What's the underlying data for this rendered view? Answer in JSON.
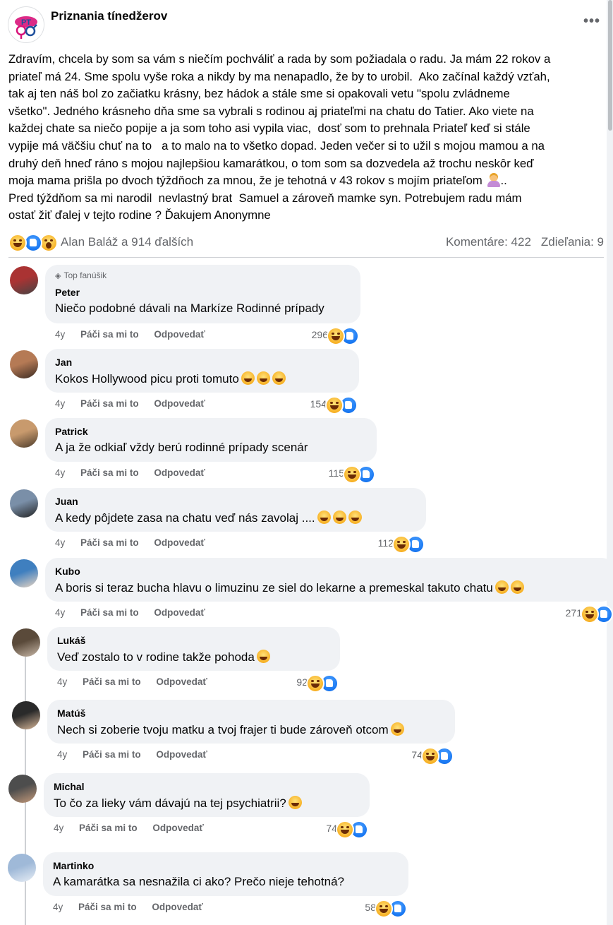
{
  "post": {
    "page_name": "Priznania tínedžerov",
    "more_label": "•••",
    "body": "Zdravím, chcela by som sa vám s niečím pochváliť a rada by som požiadala o radu. Ja mám 22 rokov a\npriateľ má 24. Sme spolu vyše roka a nikdy by ma nenapadlo, že by to urobil.  Ako začínal každý vzťah,\ntak aj ten náš bol zo začiatku krásny, bez hádok a stále sme si opakovali vetu \"spolu zvládneme\nvšetko\". Jedného krásneho dňa sme sa vybrali s rodinou aj priateľmi na chatu do Tatier. Ako viete na\nkaždej chate sa niečo popije a ja som toho asi vypila viac,  dosť som to prehnala Priateľ keď si stále\nvypije má väčšiu chuť na to   a to malo na to všetko dopad. Jeden večer si to užil s mojou mamou a na\ndruhý deň hneď ráno s mojou najlepšiou kamarátkou, o tom som sa dozvedela až trochu neskôr keď\nmoja mama prišla po dvoch týždňoch za mnou, že je tehotná v 43 rokov s mojím priateľom",
    "body_tail": "..\nPred týždňom sa mi narodil  nevlastný brat  Samuel a zároveň mamke syn. Potrebujem radu mám\nostať žiť ďalej v tejto rodine ? Ďakujem Anonymne",
    "reactions_text": "Alan Baláž a 914 ďalších",
    "comments_label": "Komentáre: 422",
    "shares_label": "Zdieľania: 9"
  },
  "comments": [
    {
      "badge": "Top fanúšik",
      "author": "Peter",
      "text": "Niečo podobné dávali na Markíze Rodinné prípady",
      "emoji": "",
      "age": "4y",
      "like": "Páči sa mi to",
      "reply": "Odpovedať",
      "count": "296"
    },
    {
      "badge": "",
      "author": "Jan",
      "text": "Kokos Hollywood picu proti tomuto",
      "emoji": "😂😂😂",
      "age": "4y",
      "like": "Páči sa mi to",
      "reply": "Odpovedať",
      "count": "154"
    },
    {
      "badge": "",
      "author": "Patrick",
      "text": "A ja že odkiaľ vždy berú rodinné prípady scenár",
      "emoji": "",
      "age": "4y",
      "like": "Páči sa mi to",
      "reply": "Odpovedať",
      "count": "115"
    },
    {
      "badge": "",
      "author": "Juan",
      "text": "A kedy pôjdete zasa na chatu veď nás zavolaj ....",
      "emoji": "🤣🤣🤣",
      "age": "4y",
      "like": "Páči sa mi to",
      "reply": "Odpovedať",
      "count": "112"
    },
    {
      "badge": "",
      "author": "Kubo",
      "text": "A boris si teraz bucha hlavu o limuzinu ze siel do lekarne a premeskal takuto chatu",
      "emoji": "😁😁",
      "age": "4y",
      "like": "Páči sa mi to",
      "reply": "Odpovedať",
      "count": "271"
    },
    {
      "badge": "",
      "author": "Lukáš",
      "text": "Veď zostalo to v rodine takže pohoda",
      "emoji": "🤣",
      "age": "4y",
      "like": "Páči sa mi to",
      "reply": "Odpovedať",
      "count": "92"
    },
    {
      "badge": "",
      "author": "Matúš",
      "text": "Nech si zoberie tvoju matku a tvoj frajer ti bude zároveň otcom",
      "emoji": "😀",
      "age": "4y",
      "like": "Páči sa mi to",
      "reply": "Odpovedať",
      "count": "74"
    },
    {
      "badge": "",
      "author": "Michal",
      "text": "To čo za lieky vám dávajú na tej psychiatrii?",
      "emoji": "😂",
      "age": "4y",
      "like": "Páči sa mi to",
      "reply": "Odpovedať",
      "count": "74"
    },
    {
      "badge": "",
      "author": "Martinko",
      "text": "A kamarátka sa nesnažila ci ako? Prečo nieje tehotná?",
      "emoji": "",
      "age": "4y",
      "like": "Páči sa mi to",
      "reply": "Odpovedať",
      "count": "58"
    }
  ],
  "colors": {
    "bubble": "#f0f2f5",
    "muted_text": "#65676b",
    "like_blue": "#1877f2",
    "haha_yellow": "#f7b125"
  },
  "icons": [
    "page-logo",
    "more-icon",
    "haha-icon",
    "like-icon",
    "wow-icon",
    "top-fan-diamond-icon",
    "avatar"
  ]
}
